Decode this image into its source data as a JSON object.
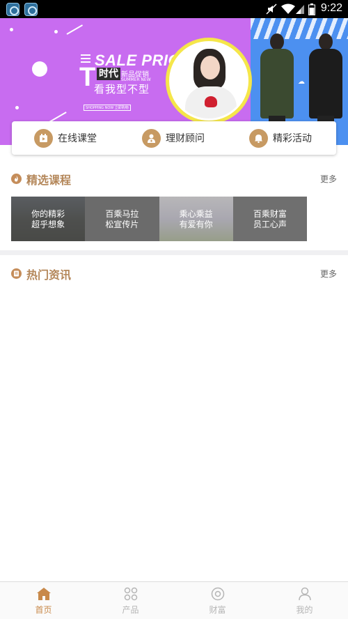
{
  "status_bar": {
    "time": "9:22",
    "icons": [
      "app-icon",
      "app-icon",
      "mute-icon",
      "wifi-icon",
      "signal-icon",
      "battery-icon"
    ]
  },
  "banner": {
    "headline": "SALE PRICE",
    "brand": "时代",
    "big_letter": "T",
    "promo": "新品促销",
    "season": "SUMMER NEW",
    "slogan": "看我型不型",
    "shop_button": "SHOPPING NOW 立即购物"
  },
  "quick_menu": [
    {
      "label": "在线课堂",
      "icon": "calendar-icon"
    },
    {
      "label": "理财顾问",
      "icon": "advisor-icon"
    },
    {
      "label": "精彩活动",
      "icon": "bell-icon"
    }
  ],
  "featured": {
    "title": "精选课程",
    "more": "更多",
    "icon": "flame-icon",
    "courses": [
      {
        "title": "你的精彩\n超乎想象",
        "bg": "#4a4e48"
      },
      {
        "title": "百乘马拉\n松宣传片",
        "bg": "#8c8c8c"
      },
      {
        "title": "乘心乘益\n有爱有你",
        "bg": "#cfcdd8"
      },
      {
        "title": "百乘财富\n员工心声",
        "bg": "#9a9a9a"
      }
    ]
  },
  "news": {
    "title": "热门资讯",
    "more": "更多",
    "icon": "document-icon"
  },
  "tabs": [
    {
      "label": "首页",
      "icon": "home-icon",
      "active": true
    },
    {
      "label": "产品",
      "icon": "grid-icon",
      "active": false
    },
    {
      "label": "财富",
      "icon": "target-icon",
      "active": false
    },
    {
      "label": "我的",
      "icon": "person-icon",
      "active": false
    }
  ],
  "colors": {
    "accent": "#c8894a",
    "banner_purple": "#c86cf0",
    "banner_blue": "#4c90f0"
  }
}
